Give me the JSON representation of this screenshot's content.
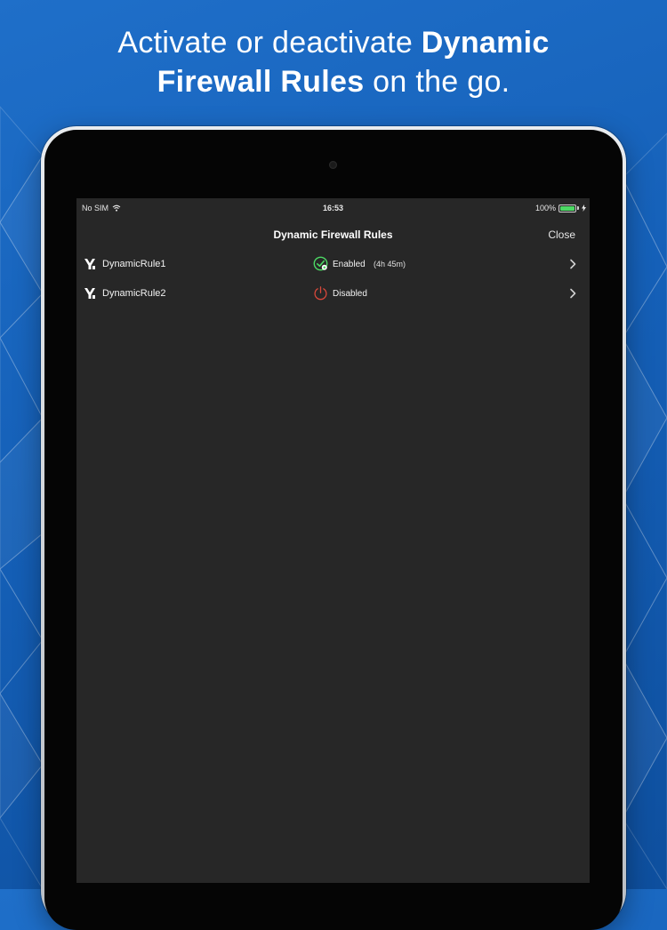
{
  "headline": {
    "line1_light": "Activate or deactivate ",
    "line1_bold": "Dynamic",
    "line2_bold": "Firewall Rules",
    "line2_light": " on the go."
  },
  "status_bar": {
    "carrier": "No SIM",
    "time": "16:53",
    "battery": "100%",
    "battery_level": 1.0
  },
  "nav": {
    "title": "Dynamic Firewall Rules",
    "close_label": "Close"
  },
  "rules": [
    {
      "name": "DynamicRule1",
      "state": "Enabled",
      "duration": "(4h 45m)",
      "icon": "check-circle-icon",
      "state_color": "#4cd964"
    },
    {
      "name": "DynamicRule2",
      "state": "Disabled",
      "duration": "",
      "icon": "power-icon",
      "state_color": "#d9483b"
    }
  ],
  "colors": {
    "background": "#1560b8",
    "screen": "#272727",
    "enabled": "#4cd964",
    "disabled": "#d9483b"
  }
}
